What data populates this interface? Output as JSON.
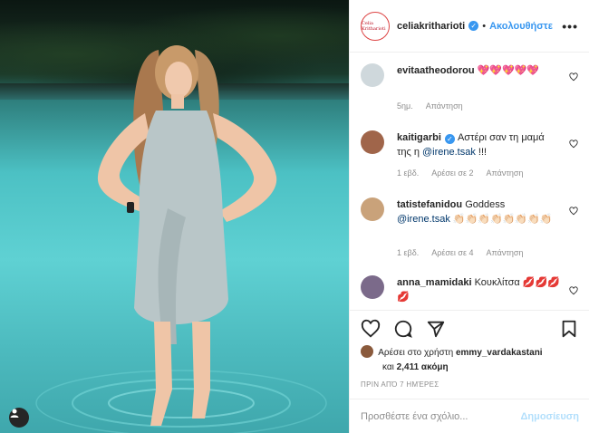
{
  "post": {
    "username": "celiakritharioti",
    "avatar_text": "Celia Kritharioti",
    "dot": "•",
    "follow_label": "Ακολουθήστε",
    "more": "•••"
  },
  "comments": [
    {
      "user": "evitaatheodorou",
      "text": "💖💖💖💖💖",
      "meta": [
        "5ημ.",
        "Απάντηση"
      ],
      "verified": false,
      "avatar_color": "#cfd8dc"
    },
    {
      "user": "kaitigarbi",
      "text_before": "Αστέρι σαν τη μαμά της η ",
      "mention": "@irene.tsak",
      "text_after": " !!!",
      "meta": [
        "1 εβδ.",
        "Αρέσει σε 2",
        "Απάντηση"
      ],
      "verified": true,
      "avatar_color": "#a0654a"
    },
    {
      "user": "tatistefanidou",
      "text_before": "Goddess ",
      "mention": "@irene.tsak",
      "text_after": " 👏🏻👏🏻👏🏻👏🏻👏🏻👏🏻👏🏻👏🏻",
      "meta": [
        "1 εβδ.",
        "Αρέσει σε 4",
        "Απάντηση"
      ],
      "verified": false,
      "avatar_color": "#c9a27a"
    },
    {
      "user": "anna_mamidaki",
      "text": "Κουκλίτσα 💋💋💋💋",
      "verified": false,
      "avatar_color": "#7b6a8a"
    }
  ],
  "likes": {
    "prefix": "Αρέσει στο χρήστη ",
    "user": "emmy_vardakastani",
    "and": "και ",
    "count": "2,411 ακόμη"
  },
  "date": "ΠΡΙΝ ΑΠΌ 7 ΗΜΈΡΕΣ",
  "comment_box": {
    "placeholder": "Προσθέστε ένα σχόλιο...",
    "post_label": "Δημοσίευση"
  },
  "colors": {
    "accent": "#3897f0",
    "muted": "#8e8e8e",
    "pool": "#5fd1d3"
  },
  "icons": [
    "heart-icon",
    "comment-icon",
    "share-icon",
    "bookmark-icon",
    "user-tag-icon",
    "more-icon"
  ]
}
